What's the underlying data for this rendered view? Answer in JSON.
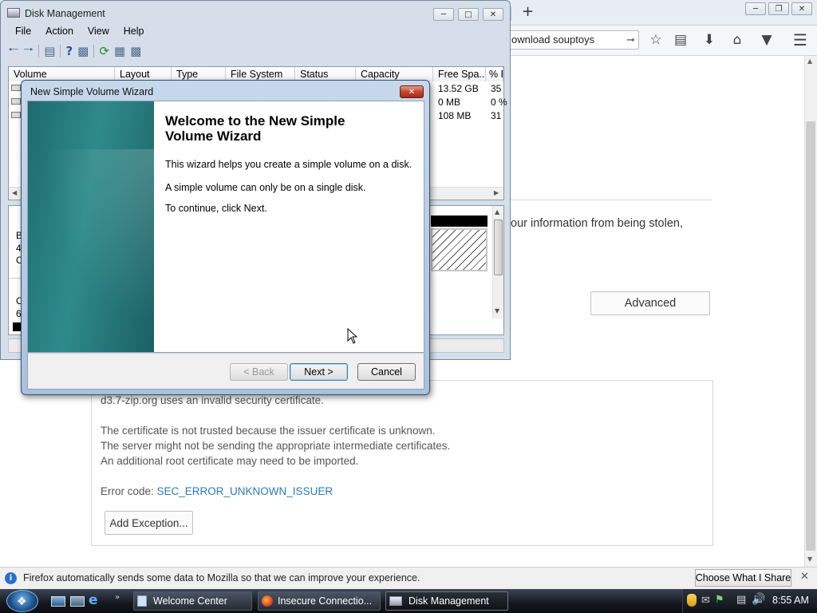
{
  "firefox": {
    "url_text": "ownload souptoys",
    "info_text": "our information from being stolen,",
    "advanced_label": "Advanced",
    "error": {
      "line1": "d3.7-zip.org uses an invalid security certificate.",
      "line2": "The certificate is not trusted because the issuer certificate is unknown.",
      "line3": "The server might not be sending the appropriate intermediate certificates.",
      "line4": "An additional root certificate may need to be imported.",
      "code_prefix": "Error code: ",
      "code": "SEC_ERROR_UNKNOWN_ISSUER",
      "add_exception": "Add Exception..."
    },
    "notification": {
      "text": "Firefox automatically sends some data to Mozilla so that we can improve your experience.",
      "button": "Choose What I Share"
    },
    "colors": {
      "link": "#0a84ff",
      "error_code": "#2b7bb9"
    }
  },
  "disk_mgmt": {
    "title": "Disk Management",
    "menu": [
      "File",
      "Action",
      "View",
      "Help"
    ],
    "columns": [
      "Volume",
      "Layout",
      "Type",
      "File System",
      "Status",
      "Capacity",
      "Free Spa...",
      "% F"
    ],
    "rows": [
      {
        "free": "13.52 GB",
        "pct": "35"
      },
      {
        "free": "0 MB",
        "pct": "0 %"
      },
      {
        "free": "108 MB",
        "pct": "31"
      }
    ],
    "graph_left_labels": [
      "B",
      "4(",
      "O",
      "C",
      "6:"
    ]
  },
  "wizard": {
    "title": "New Simple Volume Wizard",
    "heading": "Welcome to the New Simple Volume Wizard",
    "p1": "This wizard helps you create a simple volume on a disk.",
    "p2": "A simple volume can only be on a single disk.",
    "p3": "To continue, click Next.",
    "back": "< Back",
    "next": "Next >",
    "cancel": "Cancel"
  },
  "taskbar": {
    "items": [
      "Welcome Center",
      "Insecure Connectio...",
      "Disk Management"
    ],
    "clock": "8:55 AM"
  }
}
